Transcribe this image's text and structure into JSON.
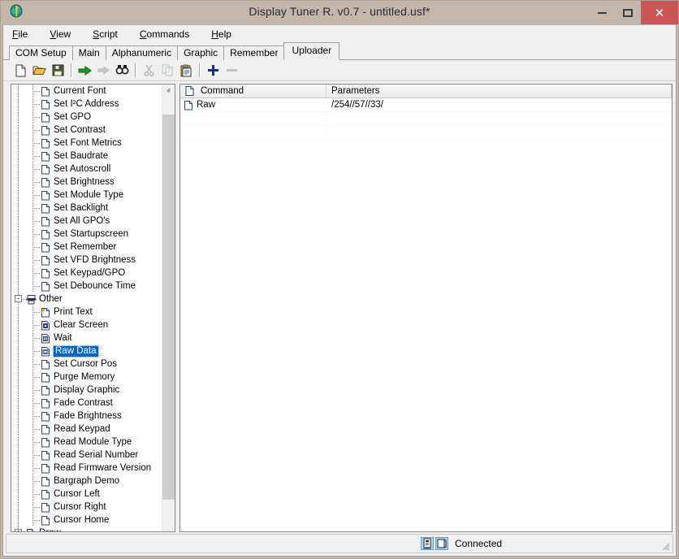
{
  "window": {
    "title": "Display Tuner R. v0.7 - untitled.usf*",
    "app_icon": "app-icon",
    "minimize_label": "Minimize",
    "maximize_label": "Maximize",
    "close_label": "✕",
    "close_color": "#cc5656",
    "frame_color": "#c3b6ab"
  },
  "menu": [
    {
      "label": "File",
      "accel": "F"
    },
    {
      "label": "View",
      "accel": "V"
    },
    {
      "label": "Script",
      "accel": "S"
    },
    {
      "label": "Commands",
      "accel": "C"
    },
    {
      "label": "Help",
      "accel": "H"
    }
  ],
  "tabs": [
    {
      "label": "COM Setup",
      "active": false
    },
    {
      "label": "Main",
      "active": false
    },
    {
      "label": "Alphanumeric",
      "active": false
    },
    {
      "label": "Graphic",
      "active": false
    },
    {
      "label": "Remember",
      "active": false
    },
    {
      "label": "Uploader",
      "active": true
    }
  ],
  "toolbar": [
    {
      "name": "new-file-icon",
      "title": "New",
      "enabled": true
    },
    {
      "name": "open-file-icon",
      "title": "Open",
      "enabled": true
    },
    {
      "name": "save-file-icon",
      "title": "Save",
      "enabled": true
    },
    {
      "name": "separator",
      "title": "",
      "enabled": true
    },
    {
      "name": "run-icon",
      "title": "Run",
      "enabled": true
    },
    {
      "name": "step-icon",
      "title": "Step",
      "enabled": false
    },
    {
      "name": "find-icon",
      "title": "Find",
      "enabled": true
    },
    {
      "name": "separator",
      "title": "",
      "enabled": true
    },
    {
      "name": "cut-icon",
      "title": "Cut",
      "enabled": false
    },
    {
      "name": "copy-icon",
      "title": "Copy",
      "enabled": false
    },
    {
      "name": "paste-icon",
      "title": "Paste",
      "enabled": true
    },
    {
      "name": "separator",
      "title": "",
      "enabled": true
    },
    {
      "name": "add-icon",
      "title": "Add",
      "enabled": true
    },
    {
      "name": "remove-icon",
      "title": "Remove",
      "enabled": false
    }
  ],
  "tree": {
    "items": [
      {
        "label": "Current Font",
        "level": 1,
        "icon": "file-icon",
        "selected": false
      },
      {
        "label": "Set I²C Address",
        "level": 1,
        "icon": "file-icon",
        "selected": false
      },
      {
        "label": "Set GPO",
        "level": 1,
        "icon": "file-icon",
        "selected": false
      },
      {
        "label": "Set Contrast",
        "level": 1,
        "icon": "file-icon",
        "selected": false
      },
      {
        "label": "Set Font Metrics",
        "level": 1,
        "icon": "file-icon",
        "selected": false
      },
      {
        "label": "Set Baudrate",
        "level": 1,
        "icon": "file-icon",
        "selected": false
      },
      {
        "label": "Set Autoscroll",
        "level": 1,
        "icon": "file-icon",
        "selected": false
      },
      {
        "label": "Set Brightness",
        "level": 1,
        "icon": "file-icon",
        "selected": false
      },
      {
        "label": "Set Module Type",
        "level": 1,
        "icon": "file-icon",
        "selected": false
      },
      {
        "label": "Set Backlight",
        "level": 1,
        "icon": "file-icon",
        "selected": false
      },
      {
        "label": "Set All GPO's",
        "level": 1,
        "icon": "file-icon",
        "selected": false
      },
      {
        "label": "Set Startupscreen",
        "level": 1,
        "icon": "file-icon",
        "selected": false
      },
      {
        "label": "Set Remember",
        "level": 1,
        "icon": "file-icon",
        "selected": false
      },
      {
        "label": "Set VFD Brightness",
        "level": 1,
        "icon": "file-icon",
        "selected": false
      },
      {
        "label": "Set Keypad/GPO",
        "level": 1,
        "icon": "file-icon",
        "selected": false
      },
      {
        "label": "Set Debounce Time",
        "level": 1,
        "icon": "file-icon",
        "selected": false
      },
      {
        "label": "Other",
        "level": 0,
        "icon": "folder-group-icon",
        "selected": false,
        "expander": "-"
      },
      {
        "label": "Print Text",
        "level": 1,
        "icon": "print-text-icon",
        "selected": false
      },
      {
        "label": "Clear Screen",
        "level": 1,
        "icon": "clear-screen-icon",
        "selected": false
      },
      {
        "label": "Wait",
        "level": 1,
        "icon": "wait-icon",
        "selected": false
      },
      {
        "label": "Raw Data",
        "level": 1,
        "icon": "raw-data-icon",
        "selected": true
      },
      {
        "label": "Set Cursor Pos",
        "level": 1,
        "icon": "file-icon",
        "selected": false
      },
      {
        "label": "Purge Memory",
        "level": 1,
        "icon": "file-icon",
        "selected": false
      },
      {
        "label": "Display Graphic",
        "level": 1,
        "icon": "file-icon",
        "selected": false
      },
      {
        "label": "Fade Contrast",
        "level": 1,
        "icon": "file-icon",
        "selected": false
      },
      {
        "label": "Fade Brightness",
        "level": 1,
        "icon": "file-icon",
        "selected": false
      },
      {
        "label": "Read Keypad",
        "level": 1,
        "icon": "file-icon",
        "selected": false
      },
      {
        "label": "Read Module Type",
        "level": 1,
        "icon": "file-icon",
        "selected": false
      },
      {
        "label": "Read Serial Number",
        "level": 1,
        "icon": "file-icon",
        "selected": false
      },
      {
        "label": "Read Firmware Version",
        "level": 1,
        "icon": "file-icon",
        "selected": false
      },
      {
        "label": "Bargraph Demo",
        "level": 1,
        "icon": "file-icon",
        "selected": false
      },
      {
        "label": "Cursor Left",
        "level": 1,
        "icon": "file-icon",
        "selected": false
      },
      {
        "label": "Cursor Right",
        "level": 1,
        "icon": "file-icon",
        "selected": false
      },
      {
        "label": "Cursor Home",
        "level": 1,
        "icon": "file-icon",
        "selected": false
      },
      {
        "label": "Draw",
        "level": 0,
        "icon": "file-icon",
        "selected": false,
        "expander": "+"
      }
    ],
    "selection_color": "#0a64c8",
    "scroll_up_glyph": "ⱏ",
    "scroll_down_glyph": "ⱟ"
  },
  "list": {
    "columns": [
      "Command",
      "Parameters"
    ],
    "rows": [
      {
        "command": "Raw",
        "parameters": "/254//57//33/",
        "icon": "file-icon"
      }
    ]
  },
  "statusbar": {
    "text": "Connected",
    "icons": [
      "serial-port-icon",
      "display-icon"
    ]
  }
}
